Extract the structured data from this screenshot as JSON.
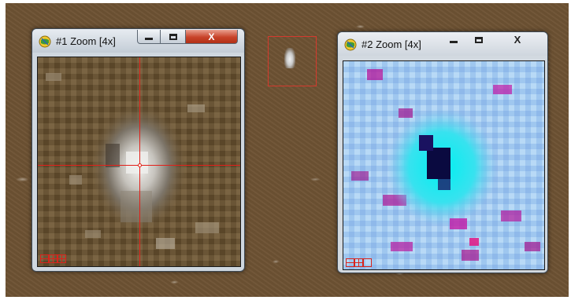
{
  "windows": [
    {
      "title": "#1 Zoom [4x]",
      "active": true,
      "close_glyph": "X",
      "view_mode": "natural-color"
    },
    {
      "title": "#2 Zoom [4x]",
      "active": false,
      "close_glyph": "X",
      "view_mode": "false-color"
    }
  ],
  "icons": {
    "app": "globe-icon",
    "minimize": "minimize-icon",
    "maximize": "maximize-icon",
    "close": "close-icon",
    "view_modes": [
      "line-mode-icon",
      "crosshair-mode-icon",
      "box-mode-icon"
    ]
  },
  "colors": {
    "crosshair": "#e1201a",
    "selection_box": "#d43a2e",
    "close_button_active": "#c8432a",
    "desktop": "#6d5233"
  }
}
